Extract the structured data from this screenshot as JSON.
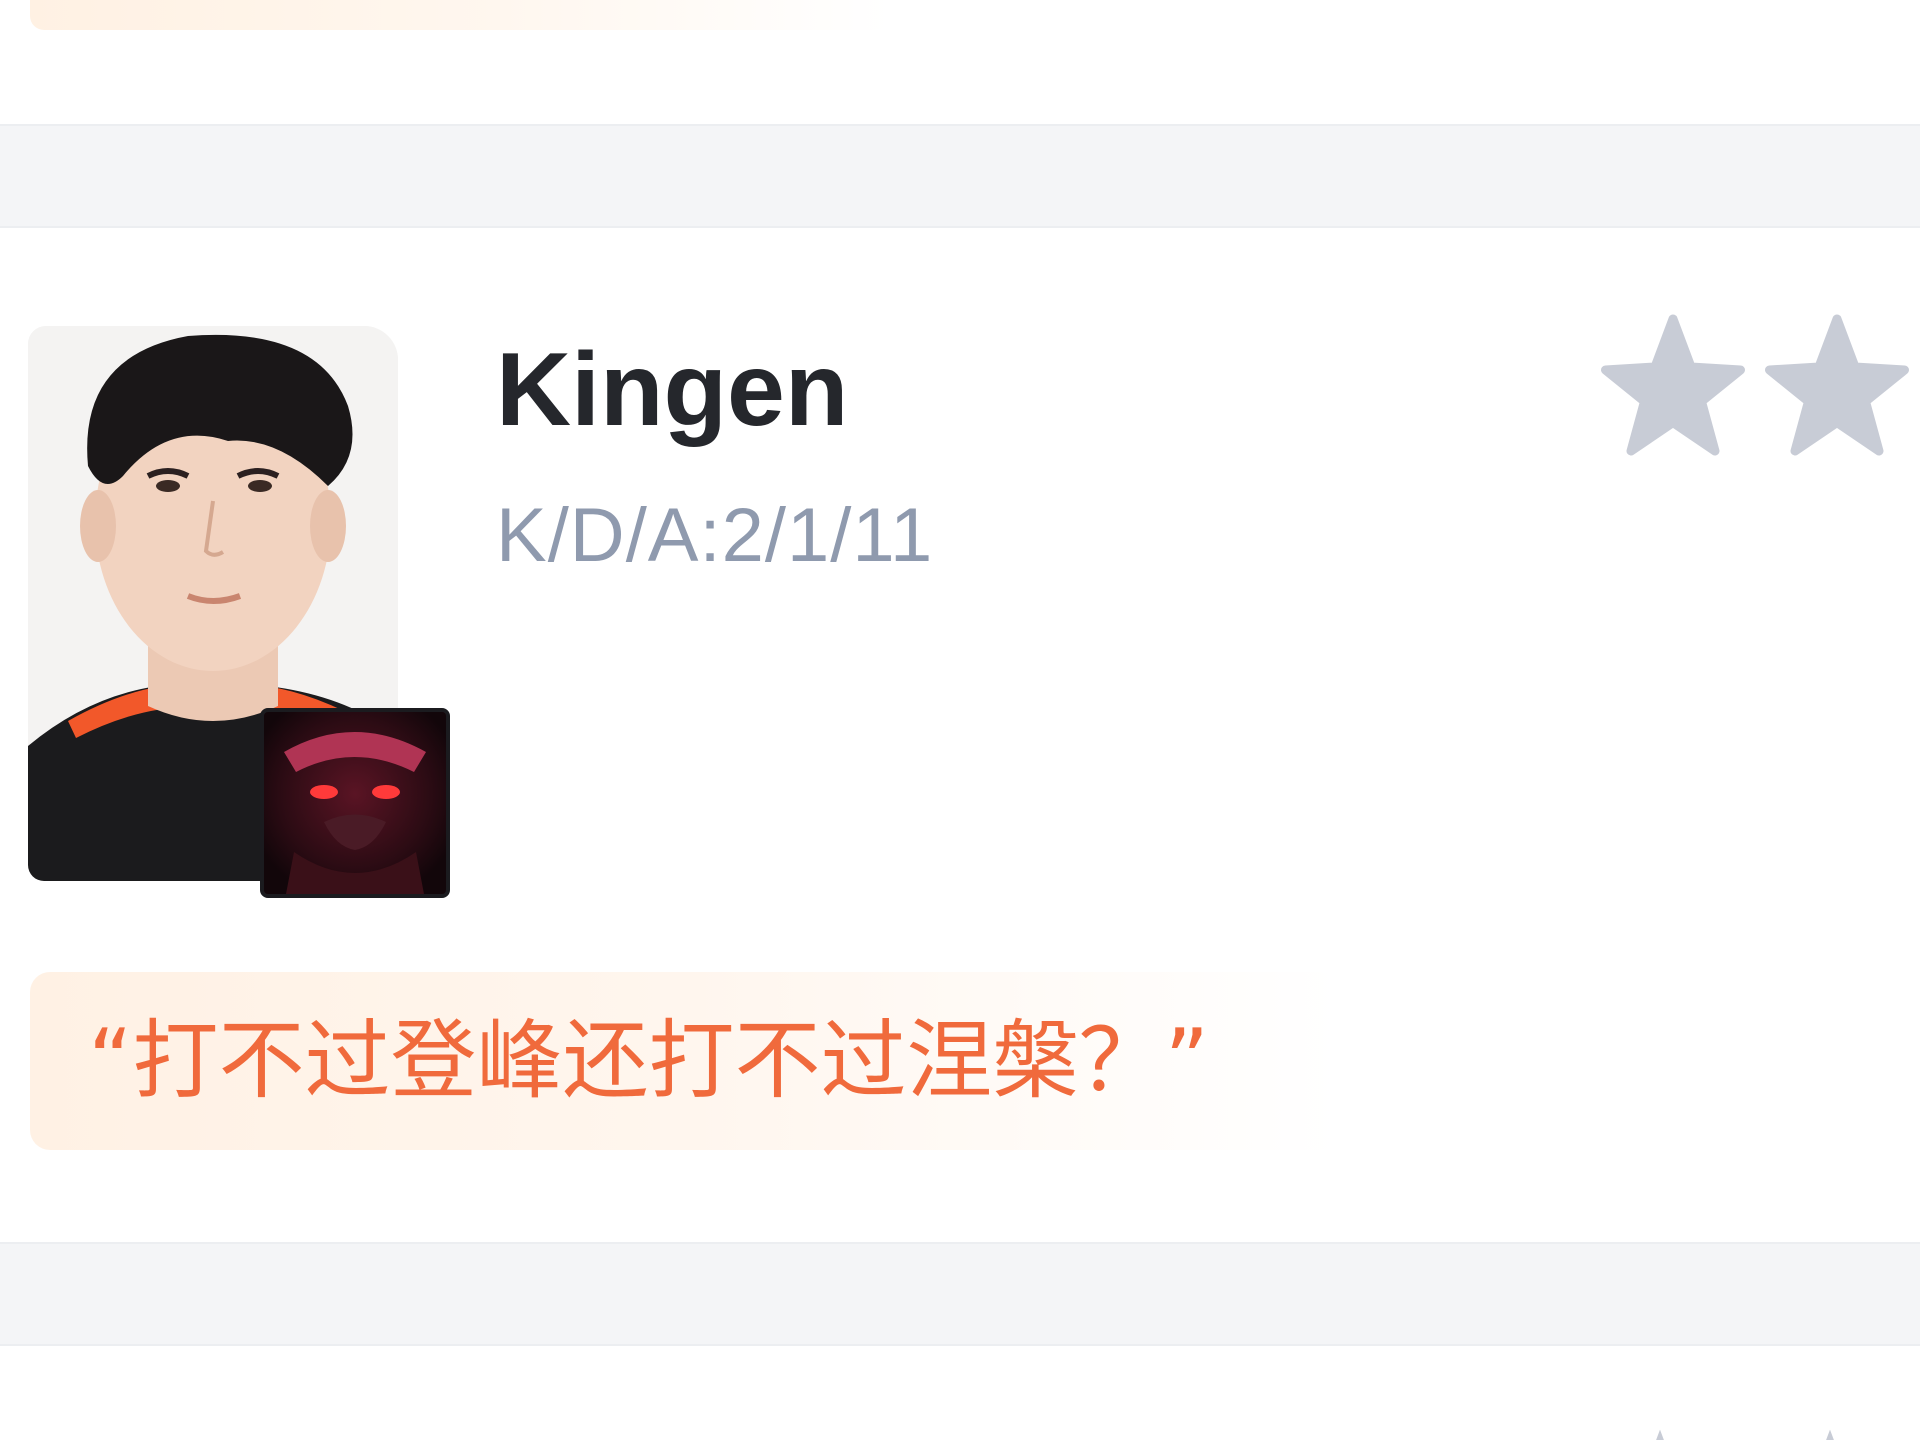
{
  "player": {
    "name": "Kingen",
    "kda": "K/D/A:2/1/11",
    "quote": "“打不过登峰还打不过涅槃？”"
  },
  "rating": {
    "shown_stars": 2,
    "star_color": "#c8ccd6"
  },
  "icons": {
    "player_avatar": "player-photo",
    "champion": "champion-portrait-icon",
    "star": "star-icon"
  },
  "colors": {
    "name": "#25272c",
    "kda": "#8f9aae",
    "quote": "#f06a3c",
    "quote_bg": "#fff1e4",
    "separator_bg": "#f4f5f7"
  }
}
